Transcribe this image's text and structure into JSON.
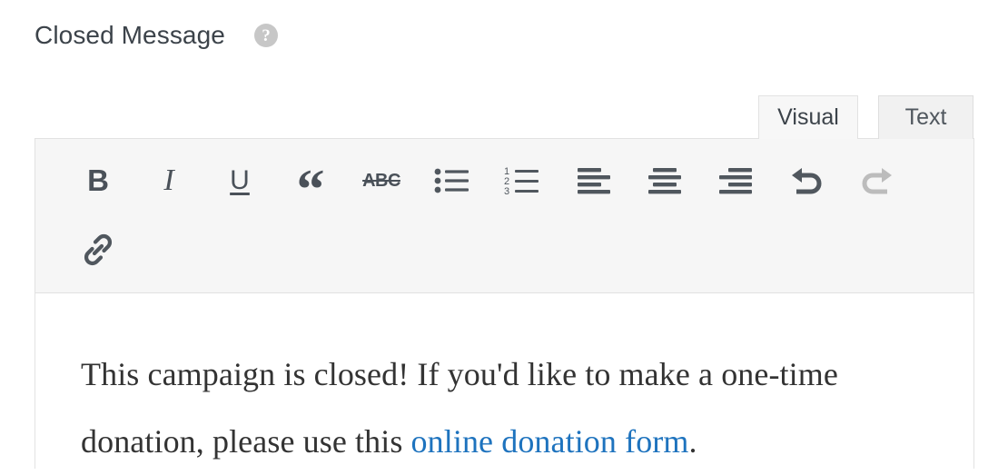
{
  "field": {
    "title": "Closed Message",
    "help_icon": "help-circle-icon",
    "help_glyph": "?"
  },
  "tabs": [
    {
      "id": "visual",
      "label": "Visual",
      "active": true
    },
    {
      "id": "text",
      "label": "Text",
      "active": false
    }
  ],
  "toolbar": {
    "rows": [
      [
        {
          "name": "bold",
          "label": "B",
          "icon": "bold-icon",
          "enabled": true
        },
        {
          "name": "italic",
          "label": "I",
          "icon": "italic-icon",
          "enabled": true
        },
        {
          "name": "underline",
          "label": "U",
          "icon": "underline-icon",
          "enabled": true
        },
        {
          "name": "blockquote",
          "label": "“",
          "icon": "blockquote-icon",
          "enabled": true
        },
        {
          "name": "strikethrough",
          "label": "ABC",
          "icon": "strikethrough-icon",
          "enabled": true
        },
        {
          "name": "bulleted-list",
          "label": "",
          "icon": "bulleted-list-icon",
          "enabled": true
        },
        {
          "name": "numbered-list",
          "label": "",
          "icon": "numbered-list-icon",
          "enabled": true
        },
        {
          "name": "align-left",
          "label": "",
          "icon": "align-left-icon",
          "enabled": true
        },
        {
          "name": "align-center",
          "label": "",
          "icon": "align-center-icon",
          "enabled": true
        },
        {
          "name": "align-right",
          "label": "",
          "icon": "align-right-icon",
          "enabled": true
        },
        {
          "name": "undo",
          "label": "",
          "icon": "undo-icon",
          "enabled": true
        },
        {
          "name": "redo",
          "label": "",
          "icon": "redo-icon",
          "enabled": false
        }
      ],
      [
        {
          "name": "insert-link",
          "label": "",
          "icon": "link-icon",
          "enabled": true
        }
      ]
    ],
    "numbered_list_digits": [
      "1",
      "2",
      "3"
    ]
  },
  "content": {
    "text_before_link": "This campaign is closed! If you'd like to make a one-time donation, please use this ",
    "link_text": "online donation form",
    "text_after_link": "."
  },
  "colors": {
    "link": "#1e73be",
    "text": "#333333",
    "label": "#3c434a",
    "toolbar_bg": "#f6f6f6",
    "icon": "#50575e",
    "icon_disabled": "#bcbcbc",
    "border": "#e2e2e2",
    "help_bg": "#c7c7c7"
  }
}
